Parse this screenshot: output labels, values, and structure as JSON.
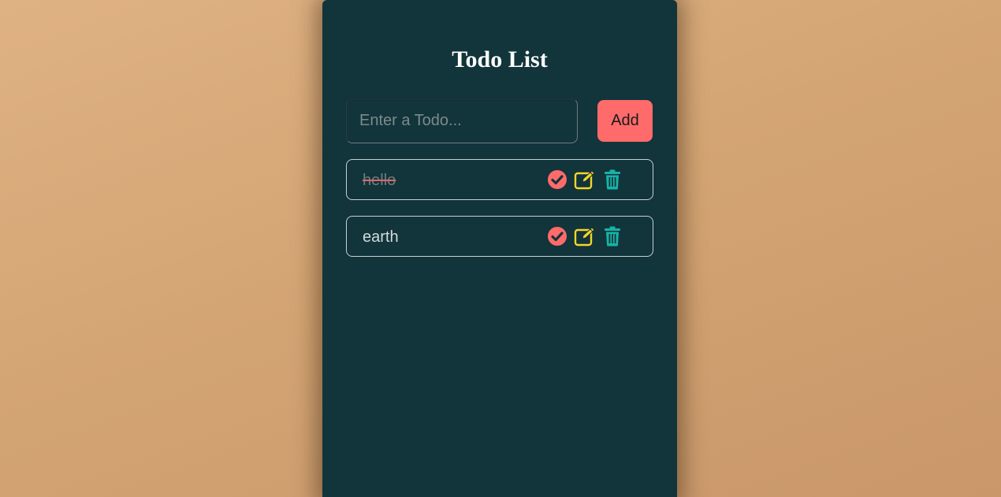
{
  "app": {
    "title": "Todo List"
  },
  "form": {
    "input_placeholder": "Enter a Todo...",
    "input_value": "",
    "add_label": "Add"
  },
  "todos": [
    {
      "text": "hello",
      "completed": true
    },
    {
      "text": "earth",
      "completed": false
    }
  ],
  "icons": {
    "complete": "check-circle-icon",
    "edit": "edit-icon",
    "delete": "trash-icon"
  },
  "colors": {
    "card_background": "#12343b",
    "accent": "#ff6b6b",
    "edit": "#f5d628",
    "delete": "#17b3a6"
  }
}
